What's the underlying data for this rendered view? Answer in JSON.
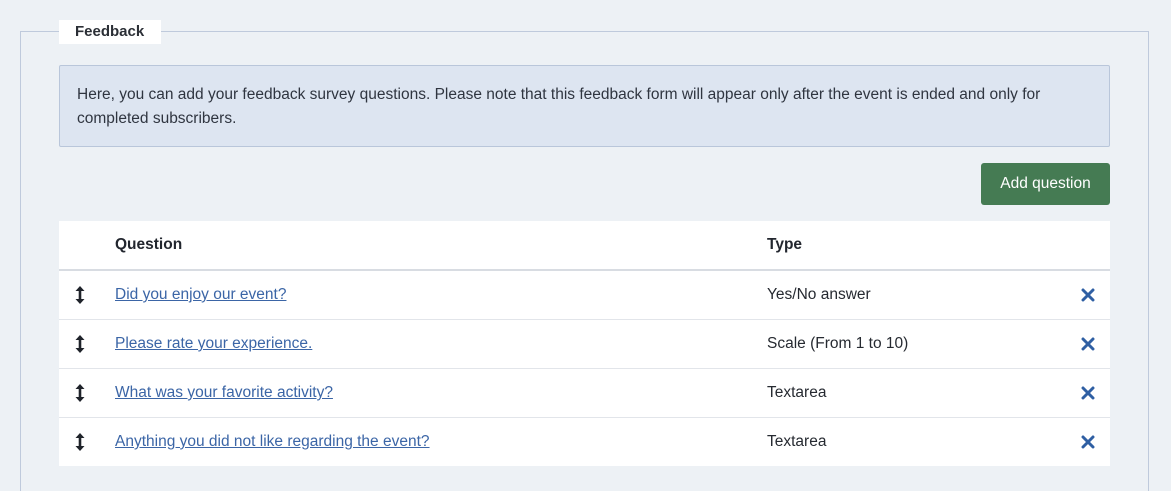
{
  "fieldset": {
    "legend": "Feedback"
  },
  "alert": {
    "text": "Here, you can add your feedback survey questions. Please note that this feedback form will appear only after the event is ended and only for completed subscribers."
  },
  "actions": {
    "add_label": "Add question"
  },
  "table": {
    "headers": {
      "question": "Question",
      "type": "Type"
    },
    "rows": [
      {
        "question": "Did you enjoy our event?",
        "type": "Yes/No answer"
      },
      {
        "question": "Please rate your experience.",
        "type": "Scale (From 1 to 10)"
      },
      {
        "question": "What was your favorite activity?",
        "type": "Textarea"
      },
      {
        "question": "Anything you did not like regarding the event?",
        "type": "Textarea"
      }
    ]
  },
  "icons": {
    "drag": "arrows-vertical-icon",
    "delete": "close-icon"
  },
  "colors": {
    "background": "#edf1f5",
    "alert_bg": "#dde5f1",
    "primary_button": "#457b53",
    "link": "#3b65a6",
    "delete_icon": "#2f5fa3"
  }
}
